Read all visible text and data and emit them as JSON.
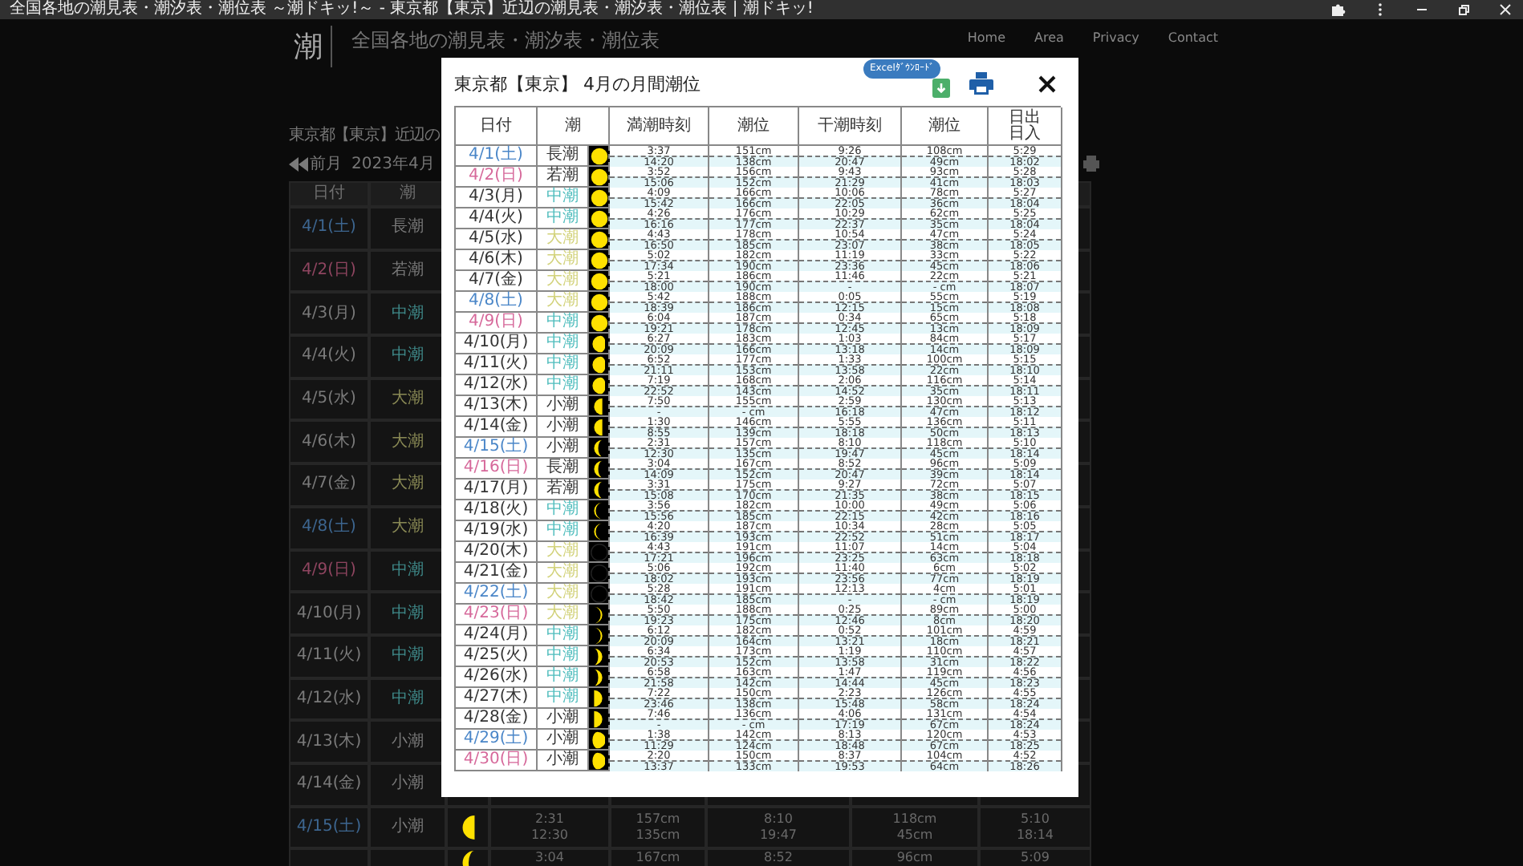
{
  "browser": {
    "title": "全国各地の潮見表・潮汐表・潮位表 ～潮ドキッ!～ - 東京都【東京】近辺の潮見表・潮汐表・潮位表 | 潮ドキッ!"
  },
  "site": {
    "logo": "潮",
    "title": "全国各地の潮見表・潮汐表・潮位表",
    "nav": [
      "Home",
      "Area",
      "Privacy",
      "Contact"
    ]
  },
  "page": {
    "heading": "東京都【東京】近辺の",
    "prev_month": "前月",
    "month": "2023年4月"
  },
  "background_table": {
    "columns": [
      "日付",
      "潮"
    ],
    "rows": [
      {
        "date": {
          "text": "4/1(土)",
          "color": "#3d6690"
        },
        "tide": {
          "text": "長潮",
          "color": "#7a7a7a"
        }
      },
      {
        "date": {
          "text": "4/2(日)",
          "color": "#8f4560"
        },
        "tide": {
          "text": "若潮",
          "color": "#7a7a7a"
        }
      },
      {
        "date": {
          "text": "4/3(月)",
          "color": "#7a7a7a"
        },
        "tide": {
          "text": "中潮",
          "color": "#3f8a8a"
        }
      },
      {
        "date": {
          "text": "4/4(火)",
          "color": "#7a7a7a"
        },
        "tide": {
          "text": "中潮",
          "color": "#3f8a8a"
        }
      },
      {
        "date": {
          "text": "4/5(水)",
          "color": "#7a7a7a"
        },
        "tide": {
          "text": "大潮",
          "color": "#8a8a55"
        }
      },
      {
        "date": {
          "text": "4/6(木)",
          "color": "#7a7a7a"
        },
        "tide": {
          "text": "大潮",
          "color": "#8a8a55"
        }
      },
      {
        "date": {
          "text": "4/7(金)",
          "color": "#7a7a7a"
        },
        "tide": {
          "text": "大潮",
          "color": "#8a8a55"
        }
      },
      {
        "date": {
          "text": "4/8(土)",
          "color": "#3d6690"
        },
        "tide": {
          "text": "大潮",
          "color": "#8a8a55"
        }
      },
      {
        "date": {
          "text": "4/9(日)",
          "color": "#8f4560"
        },
        "tide": {
          "text": "中潮",
          "color": "#3f8a8a"
        }
      },
      {
        "date": {
          "text": "4/10(月)",
          "color": "#7a7a7a"
        },
        "tide": {
          "text": "中潮",
          "color": "#3f8a8a"
        }
      },
      {
        "date": {
          "text": "4/11(火)",
          "color": "#7a7a7a"
        },
        "tide": {
          "text": "中潮",
          "color": "#3f8a8a"
        }
      },
      {
        "date": {
          "text": "4/12(水)",
          "color": "#7a7a7a"
        },
        "tide": {
          "text": "中潮",
          "color": "#3f8a8a"
        }
      },
      {
        "date": {
          "text": "4/13(木)",
          "color": "#7a7a7a"
        },
        "tide": {
          "text": "小潮",
          "color": "#7a7a7a"
        }
      },
      {
        "date": {
          "text": "4/14(金)",
          "color": "#7a7a7a"
        },
        "tide": {
          "text": "小潮",
          "color": "#7a7a7a"
        }
      },
      {
        "date": {
          "text": "4/15(土)",
          "color": "#3d6690"
        },
        "tide": {
          "text": "小潮",
          "color": "#7a7a7a"
        },
        "moon": {
          "kind": "last-quarter"
        },
        "high": [
          "2:31",
          "12:30"
        ],
        "high_level": [
          "157cm",
          "135cm"
        ],
        "low": [
          "8:10",
          "19:47"
        ],
        "low_level": [
          "118cm",
          "45cm"
        ],
        "sun": [
          "5:10",
          "18:14"
        ]
      },
      {
        "moon": {
          "kind": "waning-crescent"
        },
        "high": [
          "3:04"
        ],
        "high_level": [
          "167cm"
        ],
        "low": [
          "8:52"
        ],
        "low_level": [
          "96cm"
        ],
        "sun": [
          "5:09"
        ]
      }
    ]
  },
  "modal": {
    "title": "東京都【東京】 4月の月間潮位",
    "excel_button": "Excelﾀﾞｳﾝﾛｰﾄﾞ",
    "columns": [
      "日付",
      "潮",
      "満潮時刻",
      "潮位",
      "干潮時刻",
      "潮位"
    ],
    "sun_column": [
      "日出",
      "日入"
    ],
    "rows": [
      {
        "date": {
          "text": "4/1(土)",
          "color": "#4a86c8"
        },
        "tide": {
          "text": "長潮",
          "color": "#333333"
        },
        "moon": {
          "kind": "full"
        },
        "high": [
          "3:37",
          "14:20"
        ],
        "high_level": [
          "151cm",
          "138cm"
        ],
        "low": [
          "9:26",
          "20:47"
        ],
        "low_level": [
          "108cm",
          "49cm"
        ],
        "sun": [
          "5:29",
          "18:02"
        ]
      },
      {
        "date": {
          "text": "4/2(日)",
          "color": "#d6689a"
        },
        "tide": {
          "text": "若潮",
          "color": "#333333"
        },
        "moon": {
          "kind": "full"
        },
        "high": [
          "3:52",
          "15:06"
        ],
        "high_level": [
          "156cm",
          "152cm"
        ],
        "low": [
          "9:43",
          "21:29"
        ],
        "low_level": [
          "93cm",
          "41cm"
        ],
        "sun": [
          "5:28",
          "18:03"
        ]
      },
      {
        "date": {
          "text": "4/3(月)",
          "color": "#333333"
        },
        "tide": {
          "text": "中潮",
          "color": "#4fbdbd"
        },
        "moon": {
          "kind": "full"
        },
        "high": [
          "4:09",
          "15:42"
        ],
        "high_level": [
          "166cm",
          "166cm"
        ],
        "low": [
          "10:06",
          "22:05"
        ],
        "low_level": [
          "78cm",
          "36cm"
        ],
        "sun": [
          "5:27",
          "18:04"
        ]
      },
      {
        "date": {
          "text": "4/4(火)",
          "color": "#333333"
        },
        "tide": {
          "text": "中潮",
          "color": "#4fbdbd"
        },
        "moon": {
          "kind": "full"
        },
        "high": [
          "4:26",
          "16:16"
        ],
        "high_level": [
          "176cm",
          "177cm"
        ],
        "low": [
          "10:29",
          "22:37"
        ],
        "low_level": [
          "62cm",
          "35cm"
        ],
        "sun": [
          "5:25",
          "18:04"
        ]
      },
      {
        "date": {
          "text": "4/5(水)",
          "color": "#333333"
        },
        "tide": {
          "text": "大潮",
          "color": "#d2d27a"
        },
        "moon": {
          "kind": "full"
        },
        "high": [
          "4:43",
          "16:50"
        ],
        "high_level": [
          "178cm",
          "185cm"
        ],
        "low": [
          "10:54",
          "23:07"
        ],
        "low_level": [
          "47cm",
          "38cm"
        ],
        "sun": [
          "5:24",
          "18:05"
        ]
      },
      {
        "date": {
          "text": "4/6(木)",
          "color": "#333333"
        },
        "tide": {
          "text": "大潮",
          "color": "#d2d27a"
        },
        "moon": {
          "kind": "full"
        },
        "high": [
          "5:02",
          "17:34"
        ],
        "high_level": [
          "182cm",
          "190cm"
        ],
        "low": [
          "11:19",
          "23:36"
        ],
        "low_level": [
          "33cm",
          "45cm"
        ],
        "sun": [
          "5:22",
          "18:06"
        ]
      },
      {
        "date": {
          "text": "4/7(金)",
          "color": "#333333"
        },
        "tide": {
          "text": "大潮",
          "color": "#d2d27a"
        },
        "moon": {
          "kind": "full"
        },
        "high": [
          "5:21",
          "18:00"
        ],
        "high_level": [
          "186cm",
          "190cm"
        ],
        "low": [
          "11:46",
          "-"
        ],
        "low_level": [
          "22cm",
          "- cm"
        ],
        "sun": [
          "5:21",
          "18:07"
        ]
      },
      {
        "date": {
          "text": "4/8(土)",
          "color": "#4a86c8"
        },
        "tide": {
          "text": "大潮",
          "color": "#d2d27a"
        },
        "moon": {
          "kind": "full"
        },
        "high": [
          "5:42",
          "18:39"
        ],
        "high_level": [
          "188cm",
          "186cm"
        ],
        "low": [
          "0:05",
          "12:15"
        ],
        "low_level": [
          "55cm",
          "15cm"
        ],
        "sun": [
          "5:19",
          "18:08"
        ]
      },
      {
        "date": {
          "text": "4/9(日)",
          "color": "#d6689a"
        },
        "tide": {
          "text": "中潮",
          "color": "#4fbdbd"
        },
        "moon": {
          "kind": "full"
        },
        "high": [
          "6:04",
          "19:21"
        ],
        "high_level": [
          "187cm",
          "178cm"
        ],
        "low": [
          "0:34",
          "12:45"
        ],
        "low_level": [
          "65cm",
          "13cm"
        ],
        "sun": [
          "5:18",
          "18:09"
        ]
      },
      {
        "date": {
          "text": "4/10(月)",
          "color": "#333333"
        },
        "tide": {
          "text": "中潮",
          "color": "#4fbdbd"
        },
        "moon": {
          "kind": "waning-gibbous"
        },
        "high": [
          "6:27",
          "20:09"
        ],
        "high_level": [
          "183cm",
          "166cm"
        ],
        "low": [
          "1:03",
          "13:18"
        ],
        "low_level": [
          "84cm",
          "14cm"
        ],
        "sun": [
          "5:17",
          "18:09"
        ]
      },
      {
        "date": {
          "text": "4/11(火)",
          "color": "#333333"
        },
        "tide": {
          "text": "中潮",
          "color": "#4fbdbd"
        },
        "moon": {
          "kind": "waning-gibbous"
        },
        "high": [
          "6:52",
          "21:11"
        ],
        "high_level": [
          "177cm",
          "153cm"
        ],
        "low": [
          "1:33",
          "13:58"
        ],
        "low_level": [
          "100cm",
          "22cm"
        ],
        "sun": [
          "5:15",
          "18:10"
        ]
      },
      {
        "date": {
          "text": "4/12(水)",
          "color": "#333333"
        },
        "tide": {
          "text": "中潮",
          "color": "#4fbdbd"
        },
        "moon": {
          "kind": "waning-gibbous"
        },
        "high": [
          "7:19",
          "22:52"
        ],
        "high_level": [
          "168cm",
          "143cm"
        ],
        "low": [
          "2:06",
          "14:52"
        ],
        "low_level": [
          "116cm",
          "35cm"
        ],
        "sun": [
          "5:14",
          "18:11"
        ]
      },
      {
        "date": {
          "text": "4/13(木)",
          "color": "#333333"
        },
        "tide": {
          "text": "小潮",
          "color": "#333333"
        },
        "moon": {
          "kind": "last-quarter"
        },
        "high": [
          "7:50",
          "-"
        ],
        "high_level": [
          "155cm",
          "- cm"
        ],
        "low": [
          "2:59",
          "16:18"
        ],
        "low_level": [
          "130cm",
          "47cm"
        ],
        "sun": [
          "5:13",
          "18:12"
        ]
      },
      {
        "date": {
          "text": "4/14(金)",
          "color": "#333333"
        },
        "tide": {
          "text": "小潮",
          "color": "#333333"
        },
        "moon": {
          "kind": "last-quarter"
        },
        "high": [
          "1:30",
          "8:55"
        ],
        "high_level": [
          "146cm",
          "139cm"
        ],
        "low": [
          "5:55",
          "18:18"
        ],
        "low_level": [
          "136cm",
          "50cm"
        ],
        "sun": [
          "5:11",
          "18:13"
        ]
      },
      {
        "date": {
          "text": "4/15(土)",
          "color": "#4a86c8"
        },
        "tide": {
          "text": "小潮",
          "color": "#333333"
        },
        "moon": {
          "kind": "waning-crescent"
        },
        "high": [
          "2:31",
          "12:30"
        ],
        "high_level": [
          "157cm",
          "135cm"
        ],
        "low": [
          "8:10",
          "19:47"
        ],
        "low_level": [
          "118cm",
          "45cm"
        ],
        "sun": [
          "5:10",
          "18:14"
        ]
      },
      {
        "date": {
          "text": "4/16(日)",
          "color": "#d6689a"
        },
        "tide": {
          "text": "長潮",
          "color": "#333333"
        },
        "moon": {
          "kind": "waning-crescent"
        },
        "high": [
          "3:04",
          "14:09"
        ],
        "high_level": [
          "167cm",
          "152cm"
        ],
        "low": [
          "8:52",
          "20:47"
        ],
        "low_level": [
          "96cm",
          "39cm"
        ],
        "sun": [
          "5:09",
          "18:14"
        ]
      },
      {
        "date": {
          "text": "4/17(月)",
          "color": "#333333"
        },
        "tide": {
          "text": "若潮",
          "color": "#333333"
        },
        "moon": {
          "kind": "waning-crescent"
        },
        "high": [
          "3:31",
          "15:08"
        ],
        "high_level": [
          "175cm",
          "170cm"
        ],
        "low": [
          "9:27",
          "21:35"
        ],
        "low_level": [
          "72cm",
          "38cm"
        ],
        "sun": [
          "5:07",
          "18:15"
        ]
      },
      {
        "date": {
          "text": "4/18(火)",
          "color": "#333333"
        },
        "tide": {
          "text": "中潮",
          "color": "#4fbdbd"
        },
        "moon": {
          "kind": "thin-waning"
        },
        "high": [
          "3:56",
          "15:56"
        ],
        "high_level": [
          "182cm",
          "185cm"
        ],
        "low": [
          "10:00",
          "22:15"
        ],
        "low_level": [
          "49cm",
          "42cm"
        ],
        "sun": [
          "5:06",
          "18:16"
        ]
      },
      {
        "date": {
          "text": "4/19(水)",
          "color": "#333333"
        },
        "tide": {
          "text": "中潮",
          "color": "#4fbdbd"
        },
        "moon": {
          "kind": "thin-waning"
        },
        "high": [
          "4:20",
          "16:39"
        ],
        "high_level": [
          "187cm",
          "193cm"
        ],
        "low": [
          "10:34",
          "22:52"
        ],
        "low_level": [
          "28cm",
          "51cm"
        ],
        "sun": [
          "5:05",
          "18:17"
        ]
      },
      {
        "date": {
          "text": "4/20(木)",
          "color": "#333333"
        },
        "tide": {
          "text": "大潮",
          "color": "#d2d27a"
        },
        "moon": {
          "kind": "new"
        },
        "high": [
          "4:43",
          "17:21"
        ],
        "high_level": [
          "191cm",
          "196cm"
        ],
        "low": [
          "11:07",
          "23:25"
        ],
        "low_level": [
          "14cm",
          "63cm"
        ],
        "sun": [
          "5:04",
          "18:18"
        ]
      },
      {
        "date": {
          "text": "4/21(金)",
          "color": "#333333"
        },
        "tide": {
          "text": "大潮",
          "color": "#d2d27a"
        },
        "moon": {
          "kind": "new"
        },
        "high": [
          "5:06",
          "18:02"
        ],
        "high_level": [
          "192cm",
          "193cm"
        ],
        "low": [
          "11:40",
          "23:56"
        ],
        "low_level": [
          "6cm",
          "77cm"
        ],
        "sun": [
          "5:02",
          "18:19"
        ]
      },
      {
        "date": {
          "text": "4/22(土)",
          "color": "#4a86c8"
        },
        "tide": {
          "text": "大潮",
          "color": "#d2d27a"
        },
        "moon": {
          "kind": "new"
        },
        "high": [
          "5:28",
          "18:42"
        ],
        "high_level": [
          "191cm",
          "185cm"
        ],
        "low": [
          "12:13",
          "-"
        ],
        "low_level": [
          "4cm",
          "- cm"
        ],
        "sun": [
          "5:01",
          "18:19"
        ]
      },
      {
        "date": {
          "text": "4/23(日)",
          "color": "#d6689a"
        },
        "tide": {
          "text": "大潮",
          "color": "#d2d27a"
        },
        "moon": {
          "kind": "thin-waxing"
        },
        "high": [
          "5:50",
          "19:23"
        ],
        "high_level": [
          "188cm",
          "175cm"
        ],
        "low": [
          "0:25",
          "12:46"
        ],
        "low_level": [
          "89cm",
          "8cm"
        ],
        "sun": [
          "5:00",
          "18:20"
        ]
      },
      {
        "date": {
          "text": "4/24(月)",
          "color": "#333333"
        },
        "tide": {
          "text": "中潮",
          "color": "#4fbdbd"
        },
        "moon": {
          "kind": "thin-waxing"
        },
        "high": [
          "6:12",
          "20:09"
        ],
        "high_level": [
          "182cm",
          "164cm"
        ],
        "low": [
          "0:52",
          "13:21"
        ],
        "low_level": [
          "101cm",
          "18cm"
        ],
        "sun": [
          "4:59",
          "18:21"
        ]
      },
      {
        "date": {
          "text": "4/25(火)",
          "color": "#333333"
        },
        "tide": {
          "text": "中潮",
          "color": "#4fbdbd"
        },
        "moon": {
          "kind": "waxing-crescent"
        },
        "high": [
          "6:34",
          "20:53"
        ],
        "high_level": [
          "173cm",
          "152cm"
        ],
        "low": [
          "1:19",
          "13:58"
        ],
        "low_level": [
          "110cm",
          "31cm"
        ],
        "sun": [
          "4:57",
          "18:22"
        ]
      },
      {
        "date": {
          "text": "4/26(水)",
          "color": "#333333"
        },
        "tide": {
          "text": "中潮",
          "color": "#4fbdbd"
        },
        "moon": {
          "kind": "waxing-crescent"
        },
        "high": [
          "6:58",
          "21:58"
        ],
        "high_level": [
          "163cm",
          "142cm"
        ],
        "low": [
          "1:47",
          "14:44"
        ],
        "low_level": [
          "119cm",
          "45cm"
        ],
        "sun": [
          "4:56",
          "18:23"
        ]
      },
      {
        "date": {
          "text": "4/27(木)",
          "color": "#333333"
        },
        "tide": {
          "text": "中潮",
          "color": "#4fbdbd"
        },
        "moon": {
          "kind": "first-quarter"
        },
        "high": [
          "7:22",
          "23:46"
        ],
        "high_level": [
          "150cm",
          "138cm"
        ],
        "low": [
          "2:23",
          "15:48"
        ],
        "low_level": [
          "126cm",
          "58cm"
        ],
        "sun": [
          "4:55",
          "18:24"
        ]
      },
      {
        "date": {
          "text": "4/28(金)",
          "color": "#333333"
        },
        "tide": {
          "text": "小潮",
          "color": "#333333"
        },
        "moon": {
          "kind": "first-quarter"
        },
        "high": [
          "7:46",
          "-"
        ],
        "high_level": [
          "136cm",
          "- cm"
        ],
        "low": [
          "4:06",
          "17:19"
        ],
        "low_level": [
          "131cm",
          "67cm"
        ],
        "sun": [
          "4:54",
          "18:24"
        ]
      },
      {
        "date": {
          "text": "4/29(土)",
          "color": "#4a86c8"
        },
        "tide": {
          "text": "小潮",
          "color": "#333333"
        },
        "moon": {
          "kind": "waxing-gibbous"
        },
        "high": [
          "1:38",
          "11:29"
        ],
        "high_level": [
          "142cm",
          "124cm"
        ],
        "low": [
          "8:13",
          "18:48"
        ],
        "low_level": [
          "120cm",
          "67cm"
        ],
        "sun": [
          "4:53",
          "18:25"
        ]
      },
      {
        "date": {
          "text": "4/30(日)",
          "color": "#d6689a"
        },
        "tide": {
          "text": "小潮",
          "color": "#333333"
        },
        "moon": {
          "kind": "waxing-gibbous"
        },
        "high": [
          "2:20",
          "13:37"
        ],
        "high_level": [
          "150cm",
          "133cm"
        ],
        "low": [
          "8:37",
          "19:53"
        ],
        "low_level": [
          "104cm",
          "64cm"
        ],
        "sun": [
          "4:52",
          "18:26"
        ]
      }
    ]
  }
}
